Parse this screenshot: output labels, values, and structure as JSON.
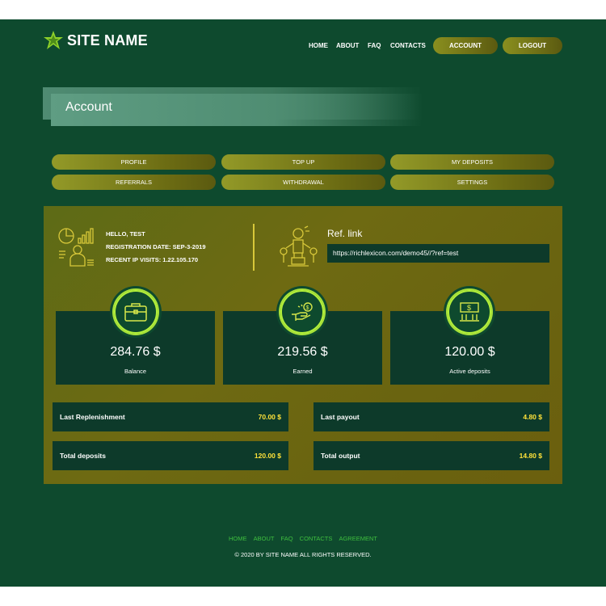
{
  "header": {
    "site_name": "SITE NAME",
    "nav": [
      "HOME",
      "ABOUT",
      "FAQ",
      "CONTACTS"
    ],
    "account_btn": "ACCOUNT",
    "logout_btn": "LOGOUT"
  },
  "page": {
    "title": "Account"
  },
  "menu": {
    "row1": [
      "PROFILE",
      "TOP UP",
      "MY DEPOSITS"
    ],
    "row2": [
      "REFERRALS",
      "WITHDRAWAL",
      "SETTINGS"
    ]
  },
  "user": {
    "greeting": "HELLO, TEST",
    "registration": "REGISTRATION DATE: SEP-3-2019",
    "visits": "RECENT IP VISITS: 1.22.105.170"
  },
  "ref": {
    "label": "Ref. link",
    "url": "https://richlexicon.com/demo45//?ref=test"
  },
  "stats": [
    {
      "value": "284.76 $",
      "label": "Balance",
      "icon": "briefcase-icon"
    },
    {
      "value": "219.56 $",
      "label": "Earned",
      "icon": "money-hand-icon"
    },
    {
      "value": "120.00 $",
      "label": "Active deposits",
      "icon": "bank-icon"
    }
  ],
  "summary": {
    "last_replenishment": {
      "label": "Last Replenishment",
      "value": "70.00 $"
    },
    "last_payout": {
      "label": "Last payout",
      "value": "4.80 $"
    },
    "total_deposits": {
      "label": "Total deposits",
      "value": "120.00 $"
    },
    "total_output": {
      "label": "Total output",
      "value": "14.80 $"
    }
  },
  "footer": {
    "links": [
      "HOME",
      "ABOUT",
      "FAQ",
      "CONTACTS",
      "AGREEMENT"
    ],
    "copyright": "© 2020 BY SITE NAME ALL RIGHTS RESERVED."
  },
  "colors": {
    "background": "#0e4a2e",
    "card": "#0d3a2a",
    "accent_yellow": "#ffe23a",
    "accent_green": "#b3f03a"
  }
}
